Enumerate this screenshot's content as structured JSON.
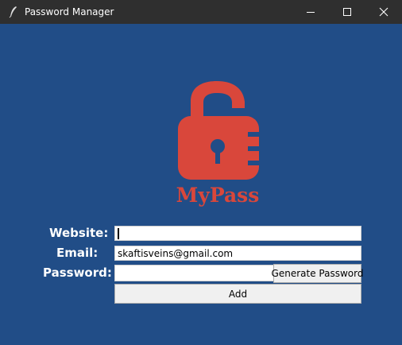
{
  "window": {
    "title": "Password Manager",
    "icons": {
      "app": "feather-icon",
      "minimize": "minimize-icon",
      "maximize": "maximize-icon",
      "close": "close-icon"
    }
  },
  "logo": {
    "text": "MyPass",
    "icon": "padlock-icon",
    "color": "#D9473B"
  },
  "form": {
    "website": {
      "label": "Website:",
      "value": ""
    },
    "email": {
      "label": "Email:",
      "value": "skaftisveins@gmail.com"
    },
    "password": {
      "label": "Password:",
      "value": ""
    },
    "generate_label": "Generate Password",
    "add_label": "Add"
  },
  "colors": {
    "background": "#214D87",
    "titlebar": "#2F2F2F",
    "accent": "#D9473B"
  }
}
